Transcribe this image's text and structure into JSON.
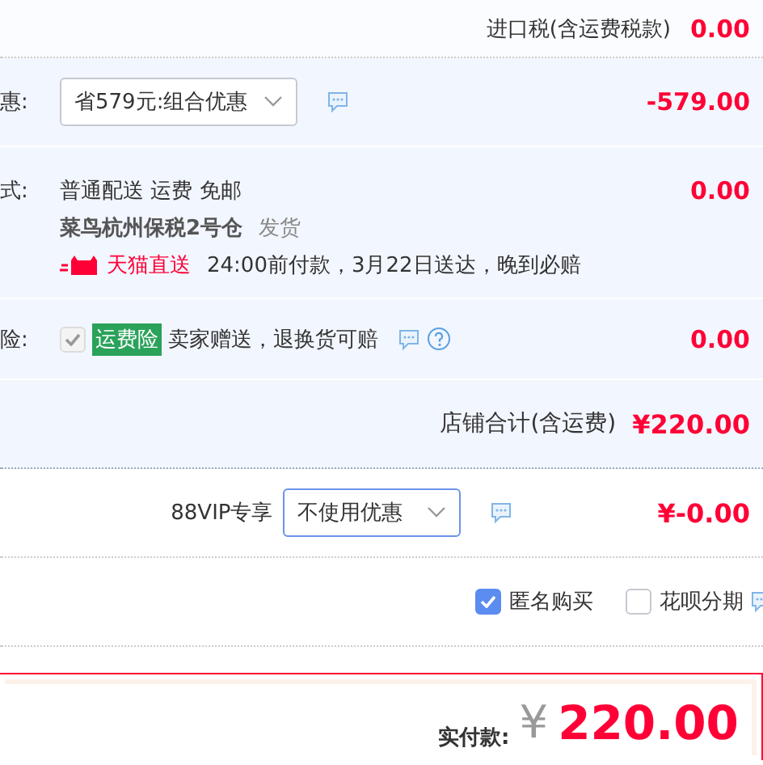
{
  "import_tax": {
    "label": "进口税(含运费税款)",
    "amount": "0.00"
  },
  "shop_rows": [
    {
      "kind": "discount",
      "label": "惠:",
      "select": "省579元:组合优惠",
      "amount": "-579.00"
    },
    {
      "kind": "shipping",
      "label": "式:",
      "method": "普通配送 运费 免邮",
      "warehouse": "菜鸟杭州保税2号仓",
      "dispatch": "发货",
      "badge": "天猫直送",
      "promise": "24:00前付款，3月22日送达，晚到必赔",
      "amount": "0.00"
    },
    {
      "kind": "insurance",
      "label": "险:",
      "checked": true,
      "disabled": true,
      "tag": "运费险",
      "note": "卖家赠送，退换货可赔",
      "amount": "0.00"
    }
  ],
  "shop_total": {
    "label": "店铺合计(含运费)",
    "amount": "¥220.00"
  },
  "vip": {
    "label": "88VIP专享",
    "select": "不使用优惠",
    "amount": "¥-0.00"
  },
  "options": [
    {
      "label": "匿名购买",
      "checked": true
    },
    {
      "label": "花呗分期",
      "checked": false
    }
  ],
  "payment": {
    "label": "实付款:",
    "currency": "¥",
    "amount": "220.00"
  }
}
